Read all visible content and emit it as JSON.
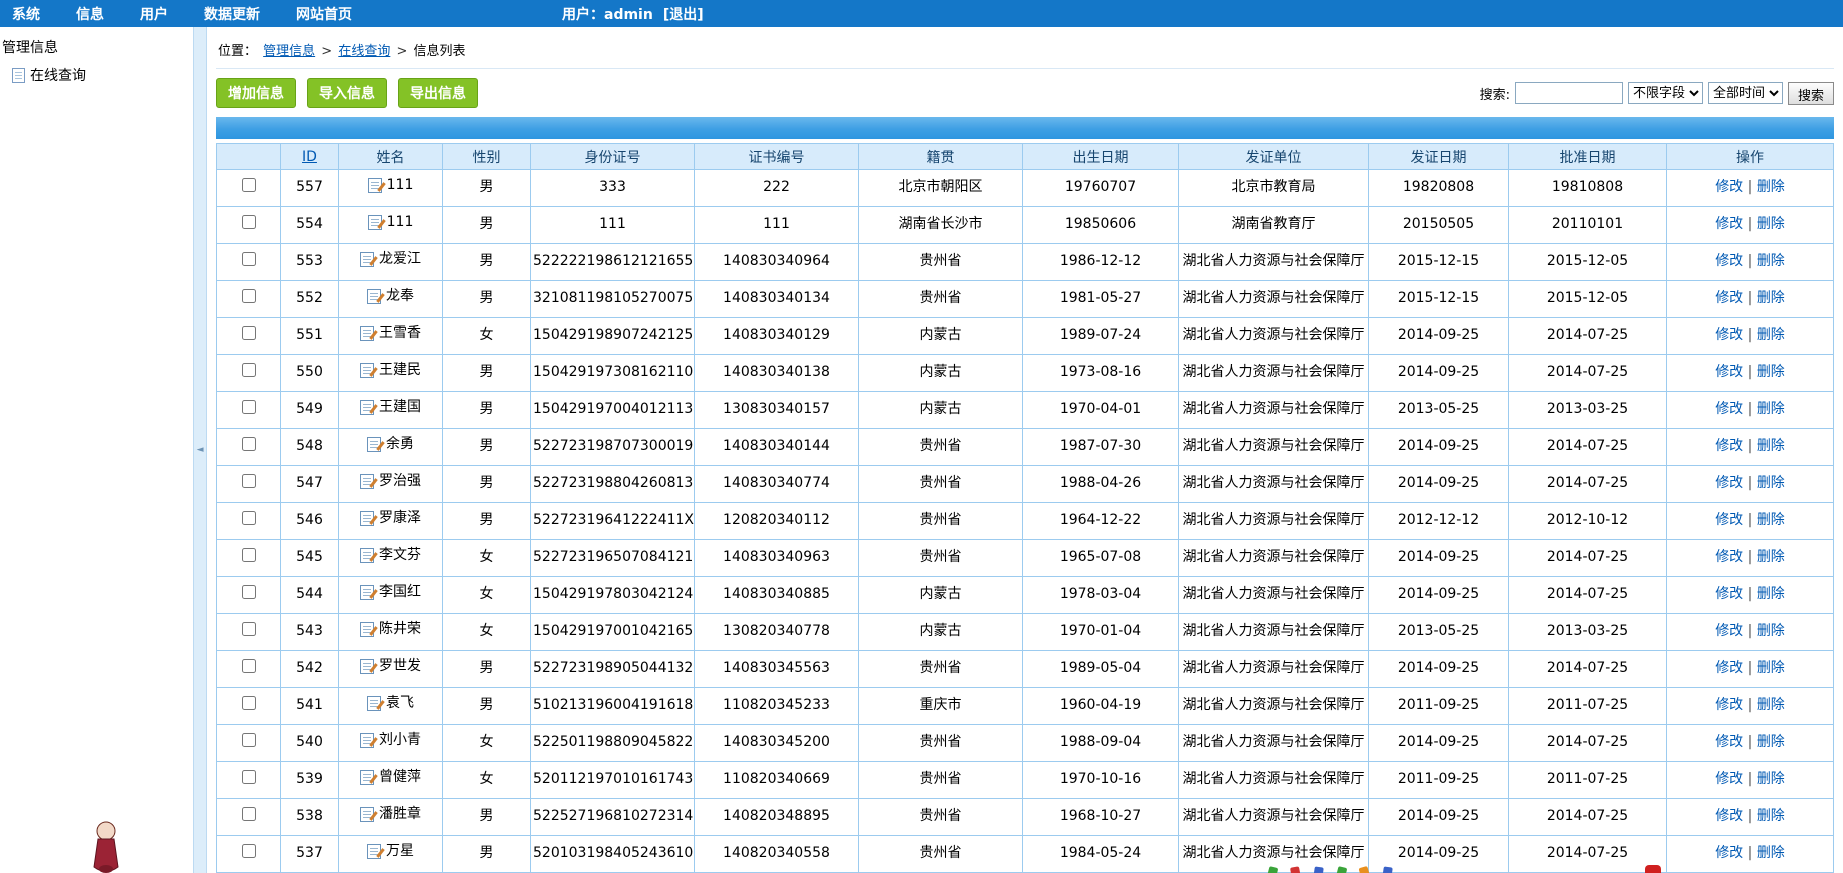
{
  "topbar": {
    "menu": [
      {
        "key": "system",
        "label": "系统"
      },
      {
        "key": "info",
        "label": "信息"
      },
      {
        "key": "user",
        "label": "用户"
      },
      {
        "key": "data-update",
        "label": "数据更新"
      },
      {
        "key": "site-home",
        "label": "网站首页"
      }
    ],
    "user_label": "用户：admin",
    "logout_label": "[退出]"
  },
  "sidebar": {
    "title": "管理信息",
    "items": [
      {
        "key": "online-query",
        "label": "在线查询"
      }
    ],
    "collapse_arrow": "◄"
  },
  "breadcrumb": {
    "prefix": "位置：",
    "links": [
      {
        "key": "manage-info",
        "label": "管理信息"
      },
      {
        "key": "online-query",
        "label": "在线查询"
      }
    ],
    "separator": ">",
    "current": "信息列表"
  },
  "toolbar": {
    "buttons": [
      {
        "key": "add-info",
        "label": "增加信息"
      },
      {
        "key": "import-info",
        "label": "导入信息"
      },
      {
        "key": "export-info",
        "label": "导出信息"
      }
    ],
    "search_label": "搜索:",
    "search_value": "",
    "field_select": "不限字段",
    "time_select": "全部时间",
    "search_button": "搜索"
  },
  "table": {
    "columns": [
      "",
      "ID",
      "姓名",
      "性别",
      "身份证号",
      "证书编号",
      "籍贯",
      "出生日期",
      "发证单位",
      "发证日期",
      "批准日期",
      "操作"
    ],
    "column_keys": [
      "select",
      "id",
      "name",
      "gender",
      "id-number",
      "cert-number",
      "origin",
      "birth-date",
      "issuer",
      "issue-date",
      "approve-date",
      "actions"
    ],
    "action_labels": [
      "修改",
      "删除"
    ],
    "rows": [
      {
        "id": "557",
        "name": "111",
        "gender": "男",
        "id_number": "333",
        "cert_number": "222",
        "origin": "北京市朝阳区",
        "birth": "19760707",
        "issuer": "北京市教育局",
        "issue_date": "19820808",
        "approve_date": "19810808"
      },
      {
        "id": "554",
        "name": "111",
        "gender": "男",
        "id_number": "111",
        "cert_number": "111",
        "origin": "湖南省长沙市",
        "birth": "19850606",
        "issuer": "湖南省教育厅",
        "issue_date": "20150505",
        "approve_date": "20110101"
      },
      {
        "id": "553",
        "name": "龙爱江",
        "gender": "男",
        "id_number": "522222198612121655",
        "cert_number": "140830340964",
        "origin": "贵州省",
        "birth": "1986-12-12",
        "issuer": "湖北省人力资源与社会保障厅",
        "issue_date": "2015-12-15",
        "approve_date": "2015-12-05"
      },
      {
        "id": "552",
        "name": "龙奉",
        "gender": "男",
        "id_number": "321081198105270075",
        "cert_number": "140830340134",
        "origin": "贵州省",
        "birth": "1981-05-27",
        "issuer": "湖北省人力资源与社会保障厅",
        "issue_date": "2015-12-15",
        "approve_date": "2015-12-05"
      },
      {
        "id": "551",
        "name": "王雪香",
        "gender": "女",
        "id_number": "150429198907242125",
        "cert_number": "140830340129",
        "origin": "内蒙古",
        "birth": "1989-07-24",
        "issuer": "湖北省人力资源与社会保障厅",
        "issue_date": "2014-09-25",
        "approve_date": "2014-07-25"
      },
      {
        "id": "550",
        "name": "王建民",
        "gender": "男",
        "id_number": "150429197308162110",
        "cert_number": "140830340138",
        "origin": "内蒙古",
        "birth": "1973-08-16",
        "issuer": "湖北省人力资源与社会保障厅",
        "issue_date": "2014-09-25",
        "approve_date": "2014-07-25"
      },
      {
        "id": "549",
        "name": "王建国",
        "gender": "男",
        "id_number": "150429197004012113",
        "cert_number": "130830340157",
        "origin": "内蒙古",
        "birth": "1970-04-01",
        "issuer": "湖北省人力资源与社会保障厅",
        "issue_date": "2013-05-25",
        "approve_date": "2013-03-25"
      },
      {
        "id": "548",
        "name": "余勇",
        "gender": "男",
        "id_number": "522723198707300019",
        "cert_number": "140830340144",
        "origin": "贵州省",
        "birth": "1987-07-30",
        "issuer": "湖北省人力资源与社会保障厅",
        "issue_date": "2014-09-25",
        "approve_date": "2014-07-25"
      },
      {
        "id": "547",
        "name": "罗治强",
        "gender": "男",
        "id_number": "522723198804260813",
        "cert_number": "140830340774",
        "origin": "贵州省",
        "birth": "1988-04-26",
        "issuer": "湖北省人力资源与社会保障厅",
        "issue_date": "2014-09-25",
        "approve_date": "2014-07-25"
      },
      {
        "id": "546",
        "name": "罗康泽",
        "gender": "男",
        "id_number": "52272319641222411X",
        "cert_number": "120820340112",
        "origin": "贵州省",
        "birth": "1964-12-22",
        "issuer": "湖北省人力资源与社会保障厅",
        "issue_date": "2012-12-12",
        "approve_date": "2012-10-12"
      },
      {
        "id": "545",
        "name": "李文芬",
        "gender": "女",
        "id_number": "522723196507084121",
        "cert_number": "140830340963",
        "origin": "贵州省",
        "birth": "1965-07-08",
        "issuer": "湖北省人力资源与社会保障厅",
        "issue_date": "2014-09-25",
        "approve_date": "2014-07-25"
      },
      {
        "id": "544",
        "name": "李国红",
        "gender": "女",
        "id_number": "150429197803042124",
        "cert_number": "140830340885",
        "origin": "内蒙古",
        "birth": "1978-03-04",
        "issuer": "湖北省人力资源与社会保障厅",
        "issue_date": "2014-09-25",
        "approve_date": "2014-07-25"
      },
      {
        "id": "543",
        "name": "陈井荣",
        "gender": "女",
        "id_number": "150429197001042165",
        "cert_number": "130820340778",
        "origin": "内蒙古",
        "birth": "1970-01-04",
        "issuer": "湖北省人力资源与社会保障厅",
        "issue_date": "2013-05-25",
        "approve_date": "2013-03-25"
      },
      {
        "id": "542",
        "name": "罗世发",
        "gender": "男",
        "id_number": "522723198905044132",
        "cert_number": "140830345563",
        "origin": "贵州省",
        "birth": "1989-05-04",
        "issuer": "湖北省人力资源与社会保障厅",
        "issue_date": "2014-09-25",
        "approve_date": "2014-07-25"
      },
      {
        "id": "541",
        "name": "袁飞",
        "gender": "男",
        "id_number": "510213196004191618",
        "cert_number": "110820345233",
        "origin": "重庆市",
        "birth": "1960-04-19",
        "issuer": "湖北省人力资源与社会保障厅",
        "issue_date": "2011-09-25",
        "approve_date": "2011-07-25"
      },
      {
        "id": "540",
        "name": "刘小青",
        "gender": "女",
        "id_number": "522501198809045822",
        "cert_number": "140830345200",
        "origin": "贵州省",
        "birth": "1988-09-04",
        "issuer": "湖北省人力资源与社会保障厅",
        "issue_date": "2014-09-25",
        "approve_date": "2014-07-25"
      },
      {
        "id": "539",
        "name": "曾健萍",
        "gender": "女",
        "id_number": "520112197010161743",
        "cert_number": "110820340669",
        "origin": "贵州省",
        "birth": "1970-10-16",
        "issuer": "湖北省人力资源与社会保障厅",
        "issue_date": "2011-09-25",
        "approve_date": "2011-07-25"
      },
      {
        "id": "538",
        "name": "潘胜章",
        "gender": "男",
        "id_number": "522527196810272314",
        "cert_number": "140820348895",
        "origin": "贵州省",
        "birth": "1968-10-27",
        "issuer": "湖北省人力资源与社会保障厅",
        "issue_date": "2014-09-25",
        "approve_date": "2014-07-25"
      },
      {
        "id": "537",
        "name": "万星",
        "gender": "男",
        "id_number": "520103198405243610",
        "cert_number": "140820340558",
        "origin": "贵州省",
        "birth": "1984-05-24",
        "issuer": "湖北省人力资源与社会保障厅",
        "issue_date": "2014-09-25",
        "approve_date": "2014-07-25"
      }
    ]
  },
  "icons": [
    "edit-note-icon",
    "doc-icon",
    "collapse-arrow-icon"
  ],
  "colors": {
    "topbar_blue": "#1477c8",
    "button_green": "#84c226",
    "table_header_bg": "#d7ebfb",
    "grid_border": "#9ccbef",
    "link_blue": "#0059b3",
    "gradient_top": "#6ab8ed",
    "gradient_bottom": "#2e96e0"
  }
}
